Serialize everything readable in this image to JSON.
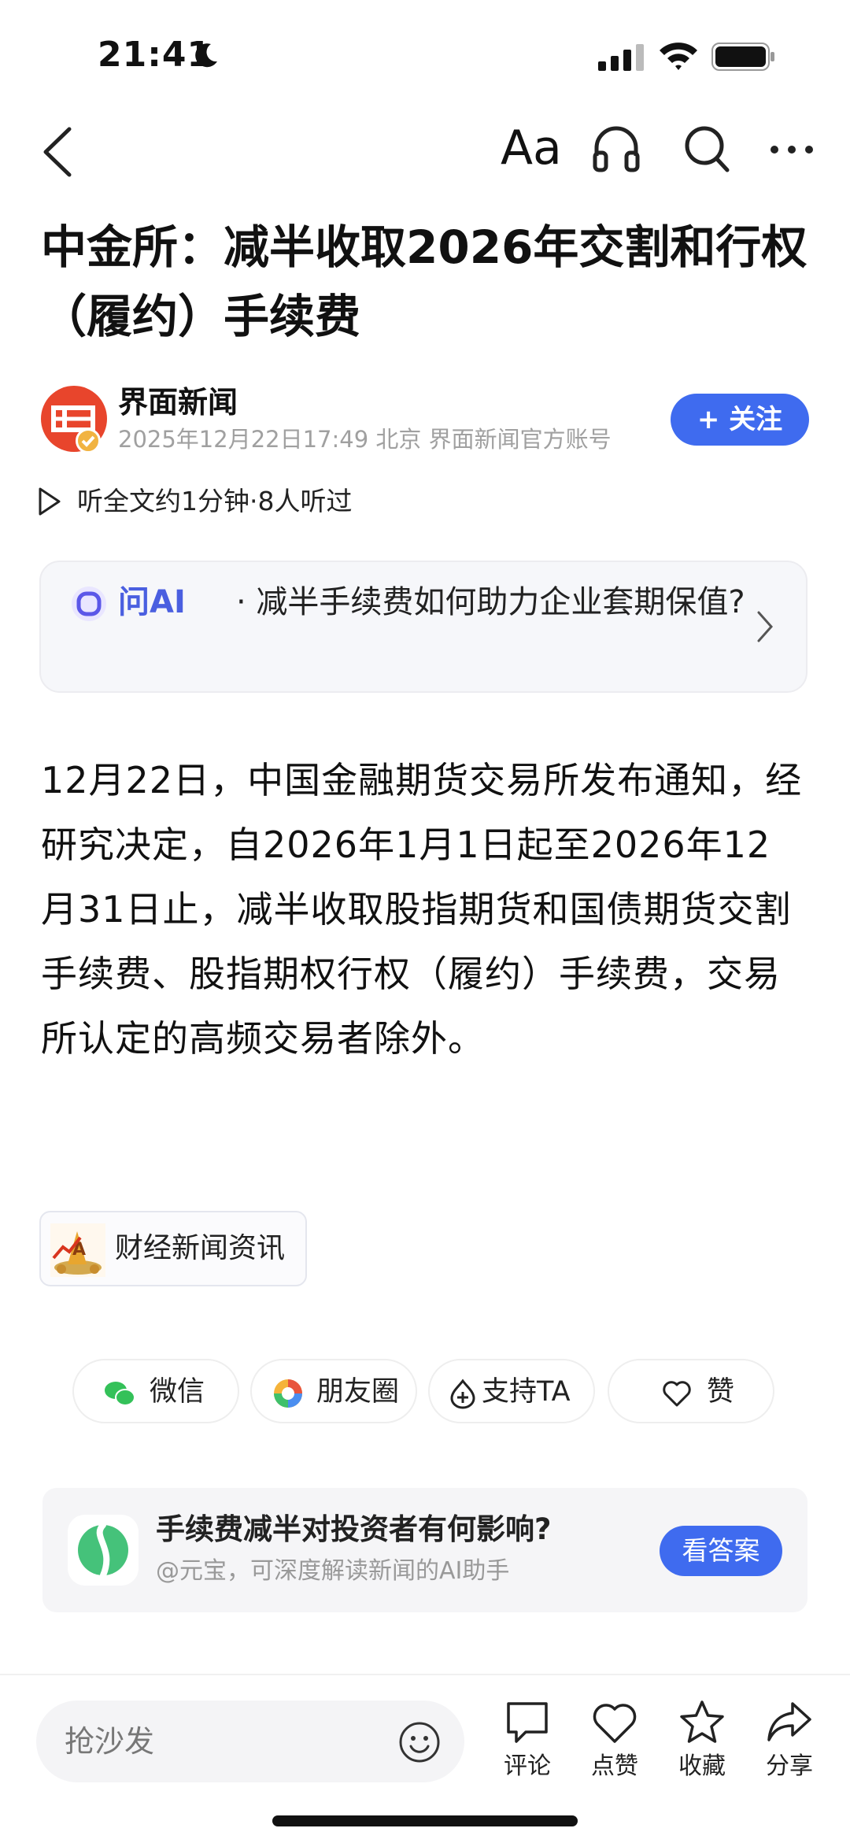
{
  "status_bar": {
    "time": "21:41"
  },
  "nav": {
    "font_size_label": "Aa"
  },
  "article": {
    "title": "中金所：减半收取2026年交割和行权（履约）手续费",
    "author": {
      "name": "界面新闻",
      "meta": "2025年12月22日17:49 北京 界面新闻官方账号",
      "follow_label": "+ 关注"
    },
    "listen_text": "听全文约1分钟·8人听过",
    "ai_card": {
      "label": "问AI",
      "question": "· 减半手续费如何助力企业套期保值?"
    },
    "body": "12月22日，中国金融期货交易所发布通知，经研究决定，自2026年1月1日起至2026年12月31日止，减半收取股指期货和国债期货交割手续费、股指期权行权（履约）手续费，交易所认定的高频交易者除外。",
    "tag_label": "财经新闻资讯"
  },
  "share": {
    "wechat": "微信",
    "moments": "朋友圈",
    "support": "支持TA",
    "like": "赞"
  },
  "promo": {
    "question": "手续费减半对投资者有何影响?",
    "subtitle": "@元宝，可深度解读新闻的AI助手",
    "button": "看答案"
  },
  "bottom_bar": {
    "comment_placeholder": "抢沙发",
    "actions": {
      "comment": "评论",
      "like": "点赞",
      "favorite": "收藏",
      "share": "分享"
    }
  },
  "colors": {
    "accent": "#3f6bef",
    "ai_text": "#4a5fe0",
    "avatar": "#e8452c"
  }
}
